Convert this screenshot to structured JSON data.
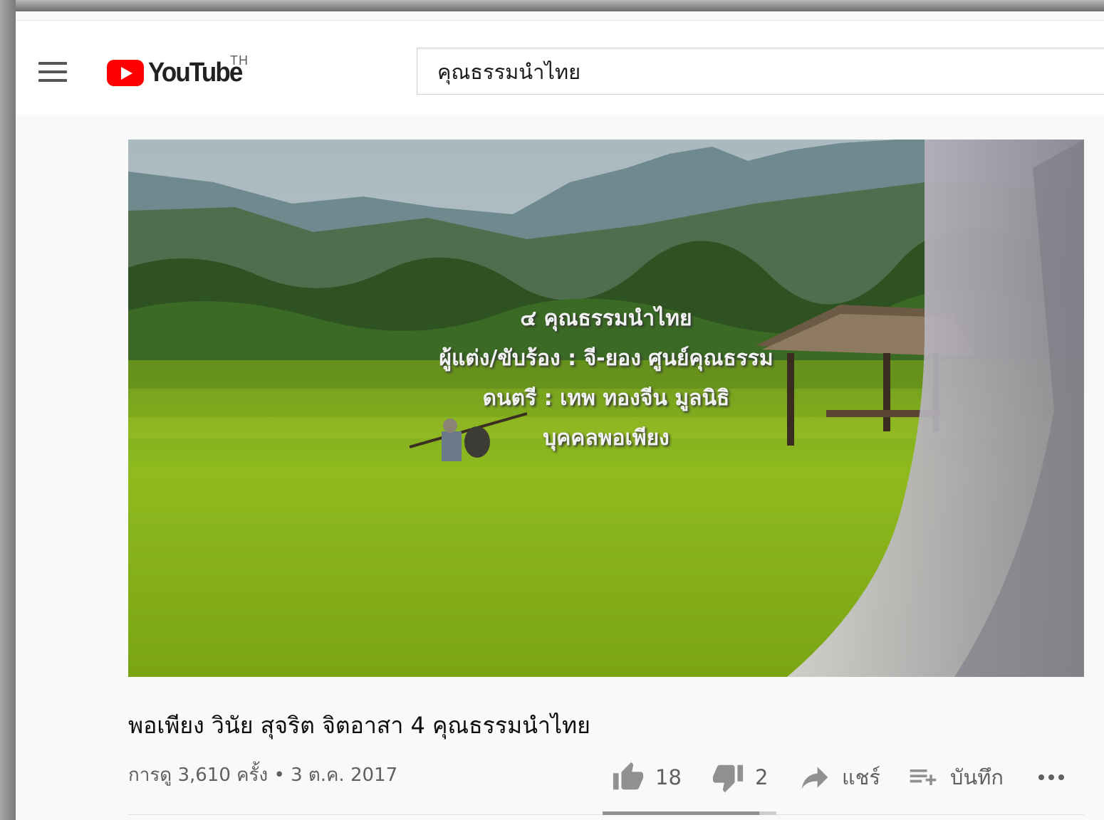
{
  "masthead": {
    "logo_text": "YouTube",
    "country_code": "TH",
    "search_value": "คุณธรรมนำไทย"
  },
  "video": {
    "overlay_lines": [
      "๔ คุณธรรมนำไทย",
      "ผู้แต่ง/ขับร้อง : จี-ยอง ศูนย์คุณธรรม",
      "ดนตรี : เทพ ทองจีน มูลนิธิ",
      "บุคคลพอเพียง"
    ]
  },
  "info": {
    "title": "พอเพียง วินัย สุจริต จิตอาสา 4 คุณธรรมนำไทย",
    "views_date": "การดู 3,610 ครั้ง • 3 ต.ค. 2017",
    "likes": "18",
    "dislikes": "2",
    "share_label": "แชร์",
    "save_label": "บันทึก",
    "like_ratio": 0.9
  },
  "icons": {
    "menu": "hamburger-menu-icon",
    "like": "thumbs-up-icon",
    "dislike": "thumbs-down-icon",
    "share": "share-arrow-icon",
    "save": "playlist-add-icon",
    "more": "more-horizontal-icon"
  },
  "colors": {
    "brand_red": "#ff0000",
    "text_primary": "#0d0d0d",
    "text_secondary": "#606060"
  }
}
